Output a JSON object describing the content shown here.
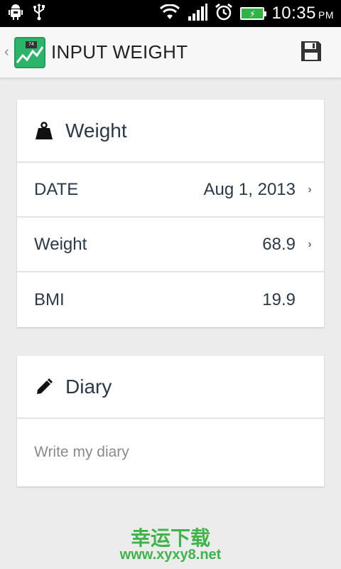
{
  "status_bar": {
    "time": "10:35",
    "ampm": "PM",
    "icons": [
      "android-debug-icon",
      "usb-icon",
      "wifi-icon",
      "signal-icon",
      "alarm-icon",
      "battery-charging-icon"
    ]
  },
  "action_bar": {
    "title": "INPUT WEIGHT",
    "app_icon_text": "74",
    "save_icon": "save-icon"
  },
  "weight_card": {
    "title": "Weight",
    "icon": "weight-icon",
    "rows": [
      {
        "label": "DATE",
        "value": "Aug 1, 2013"
      },
      {
        "label": "Weight",
        "value": "68.9"
      },
      {
        "label": "BMI",
        "value": "19.9"
      }
    ]
  },
  "diary_card": {
    "title": "Diary",
    "icon": "pencil-icon",
    "placeholder": "Write my diary"
  },
  "watermark": {
    "line1": "幸运下载",
    "line2": "www.xyxy8.net"
  },
  "colors": {
    "accent_green": "#2db46b",
    "text_dark": "#2b3a4a",
    "watermark_green": "#3db54a"
  }
}
